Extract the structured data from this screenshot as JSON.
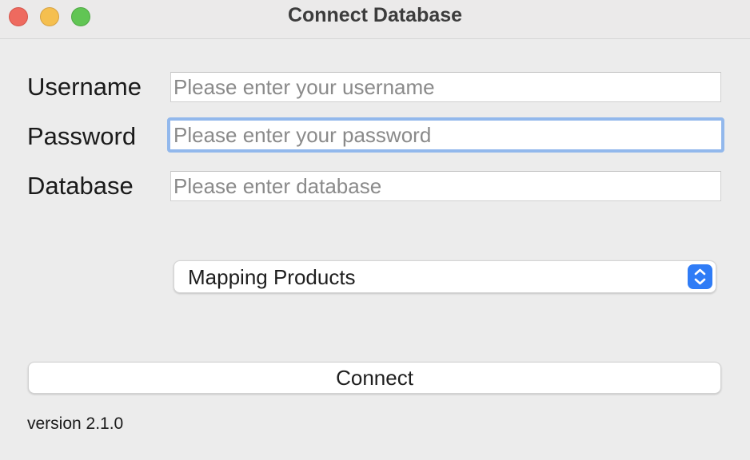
{
  "window": {
    "title": "Connect Database"
  },
  "form": {
    "username": {
      "label": "Username",
      "value": "",
      "placeholder": "Please enter your username"
    },
    "password": {
      "label": "Password",
      "value": "",
      "placeholder": "Please enter your password",
      "focused": true
    },
    "database": {
      "label": "Database",
      "value": "",
      "placeholder": "Please enter database"
    },
    "mode_select": {
      "selected": "Mapping Products",
      "icon": "up-down-chevron-icon"
    },
    "connect_label": "Connect"
  },
  "footer": {
    "version": "version 2.1.0"
  },
  "colors": {
    "focus_ring": "#92b8ec",
    "stepper_accent": "#2f7cf6",
    "close": "#ee6a5f",
    "minimize": "#f5bf4f",
    "zoom": "#61c554"
  }
}
